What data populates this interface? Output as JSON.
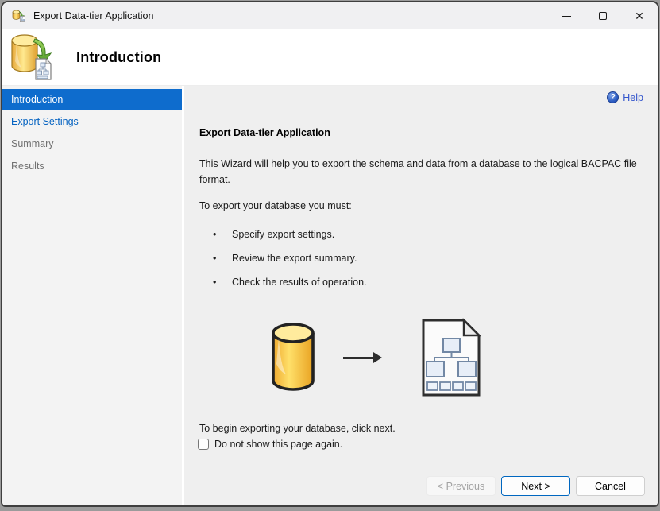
{
  "window": {
    "title": "Export Data-tier Application"
  },
  "icons": {
    "close_glyph": "✕",
    "help_glyph": "?"
  },
  "header": {
    "title": "Introduction"
  },
  "sidebar": {
    "items": [
      {
        "label": "Introduction",
        "state": "selected"
      },
      {
        "label": "Export Settings",
        "state": "link"
      },
      {
        "label": "Summary",
        "state": "muted"
      },
      {
        "label": "Results",
        "state": "muted"
      }
    ]
  },
  "content": {
    "help_label": "Help",
    "heading": "Export Data-tier Application",
    "intro_text": "This Wizard will help you to export the schema and data from a database to the logical BACPAC file format.",
    "requirements_intro": "To export your database you must:",
    "bullets": [
      "Specify export settings.",
      "Review the export summary.",
      "Check the results of operation."
    ],
    "begin_text": "To begin exporting your database, click next.",
    "checkbox_label": "Do not show this page again.",
    "checkbox_checked": false
  },
  "buttons": {
    "previous": "< Previous",
    "next": "Next >",
    "cancel": "Cancel"
  },
  "colors": {
    "selected_item_bg": "#0e6ccd",
    "link_blue": "#0563c1",
    "muted_gray": "#717171",
    "help_blue": "#3355cc",
    "default_button_border": "#0067c0",
    "cylinder_yellow": "#fdd24f",
    "arrow_green": "#6cb33f"
  }
}
